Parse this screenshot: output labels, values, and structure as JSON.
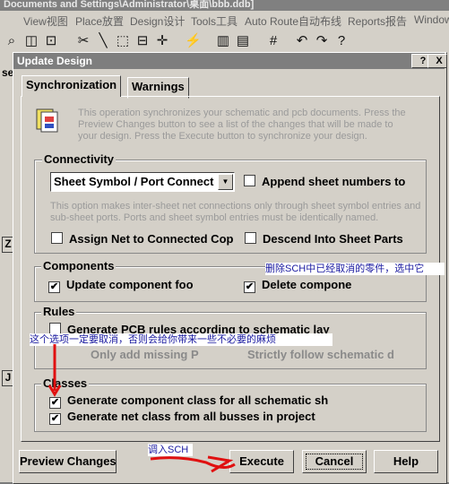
{
  "app": {
    "title": "Documents and Settings\\Administrator\\桌面\\bbb.ddb]",
    "menu": [
      "View视图",
      "Place放置",
      "Design设计",
      "Tools工具",
      "Auto Route自动布线",
      "Reports报告",
      "Window"
    ]
  },
  "left_pane": {
    "item1": "se",
    "item2": "Z",
    "item3": "J"
  },
  "dialog": {
    "title": "Update Design",
    "help_btn": "?",
    "close_btn": "X",
    "tabs": [
      "Synchronization",
      "Warnings"
    ],
    "intro": "This operation synchronizes your schematic and pcb documents.  Press the Preview Changes button to see a list of the changes that will be made to your design.  Press the Execute button to synchronize your design.",
    "connectivity": {
      "label": "Connectivity",
      "select_value": "Sheet Symbol / Port Connect",
      "append_sheet": "Append sheet numbers to",
      "note": "This option makes inter-sheet net connections only through sheet symbol entries and sub-sheet ports. Ports and sheet symbol entries must be identically named.",
      "assign_net": "Assign Net to Connected Cop",
      "descend": "Descend Into Sheet Parts"
    },
    "components": {
      "label": "Components",
      "update_footprint": "Update component foo",
      "delete_components": "Delete compone"
    },
    "rules": {
      "label": "Rules",
      "generate_pcb_rules": "Generate PCB rules according to schematic lay",
      "only_add_missing": "Only add missing P",
      "strictly_follow": "Strictly follow schematic d"
    },
    "classes": {
      "label": "Classes",
      "component_class": "Generate component class for all schematic sh",
      "net_class": "Generate net class from all busses in project"
    },
    "buttons": {
      "preview": "Preview Changes",
      "execute": "Execute",
      "cancel": "Cancel",
      "help": "Help"
    }
  },
  "annotations": {
    "delete_note": "删除SCH中已经取消的零件，选中它",
    "uncheck_note": "这个选项一定要取消，否则会给你带来一些不必要的麻烦",
    "import_note": "调入SCH"
  }
}
